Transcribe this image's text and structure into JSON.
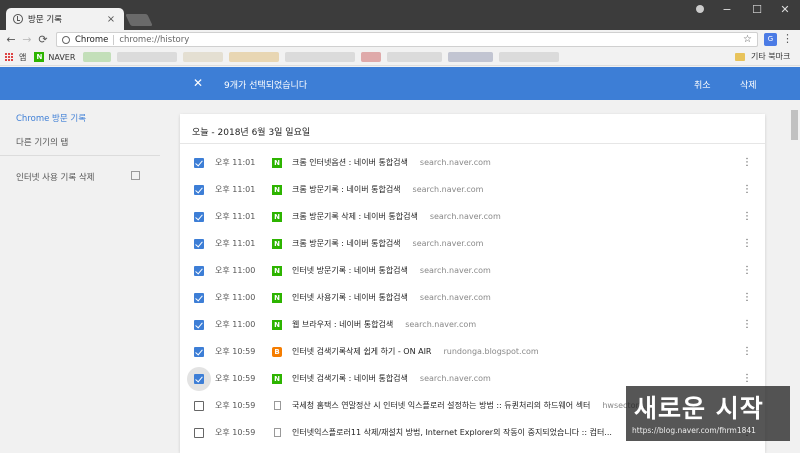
{
  "browser": {
    "tab_title": "방문 기록",
    "tab_close": "×",
    "chip_label": "Chrome",
    "url": "chrome://history",
    "star_glyph": "☆",
    "back_glyph": "←",
    "forward_glyph": "→",
    "reload_glyph": "⟳",
    "menu_glyph": "⋮",
    "ext_label": "G",
    "win_min": "−",
    "win_max": "☐",
    "win_close": "✕"
  },
  "bookmarks": {
    "apps_label": "앱",
    "naver_label": "NAVER",
    "naver_mark": "N",
    "other_label": "기타 북마크"
  },
  "selection_bar": {
    "close_glyph": "✕",
    "message": "9개가 선택되었습니다",
    "cancel_label": "취소",
    "delete_label": "삭제",
    "color": "#3d7ed6"
  },
  "sidebar": {
    "items": [
      {
        "label": "Chrome 방문 기록",
        "active": true
      },
      {
        "label": "다른 기기의 탭",
        "active": false
      },
      {
        "label": "인터넷 사용 기록 삭제",
        "active": false
      }
    ]
  },
  "history": {
    "date_heading": "오늘 - 2018년 6월 3일 일요일",
    "row_menu_glyph": "⋮",
    "rows": [
      {
        "checked": true,
        "time": "오후 11:01",
        "favicon": "naver",
        "title": "크롬 인터넷옵션 : 네이버 통합검색",
        "domain": "search.naver.com"
      },
      {
        "checked": true,
        "time": "오후 11:01",
        "favicon": "naver",
        "title": "크롬 방문기록 : 네이버 통합검색",
        "domain": "search.naver.com"
      },
      {
        "checked": true,
        "time": "오후 11:01",
        "favicon": "naver",
        "title": "크롬 방문기록 삭제 : 네이버 통합검색",
        "domain": "search.naver.com"
      },
      {
        "checked": true,
        "time": "오후 11:01",
        "favicon": "naver",
        "title": "크롬 방문기록 : 네이버 통합검색",
        "domain": "search.naver.com"
      },
      {
        "checked": true,
        "time": "오후 11:00",
        "favicon": "naver",
        "title": "인터넷 방문기록 : 네이버 통합검색",
        "domain": "search.naver.com"
      },
      {
        "checked": true,
        "time": "오후 11:00",
        "favicon": "naver",
        "title": "인터넷 사용기록 : 네이버 통합검색",
        "domain": "search.naver.com"
      },
      {
        "checked": true,
        "time": "오후 11:00",
        "favicon": "naver",
        "title": "웹 브라우저 : 네이버 통합검색",
        "domain": "search.naver.com"
      },
      {
        "checked": true,
        "time": "오후 10:59",
        "favicon": "blogger",
        "title": "인터넷 검색기록삭제 쉽게 하기 - ON AIR",
        "domain": "rundonga.blogspot.com"
      },
      {
        "checked": true,
        "time": "오후 10:59",
        "favicon": "naver",
        "title": "인터넷 검색기록 : 네이버 통합검색",
        "domain": "search.naver.com"
      },
      {
        "checked": false,
        "time": "오후 10:59",
        "favicon": "doc",
        "title": "국세청 홈택스 연말정산 시 인터넷 익스플로러 설정하는 방법 :: 듀퀸처리의 하드웨어 섹터",
        "domain": "hwsector..."
      },
      {
        "checked": false,
        "time": "오후 10:59",
        "favicon": "doc",
        "title": "인터넷익스플로러11 삭제/재설치 방법, Internet Explorer의 작동이 중지되었습니다 :: 컴터...",
        "domain": ""
      }
    ]
  },
  "watermark": {
    "title": "새로운 시작",
    "url": "https://blog.naver.com/fhrm1841"
  }
}
